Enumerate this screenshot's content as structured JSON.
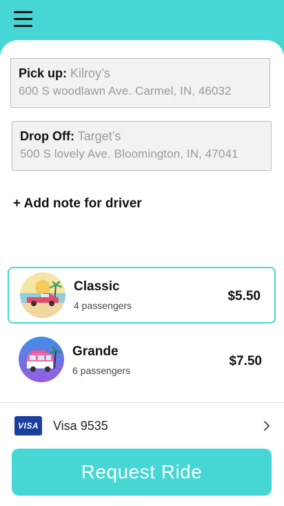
{
  "header": {
    "menu_icon": "hamburger-menu-icon"
  },
  "pickup": {
    "label": "Pick up:",
    "place": "Kilroy’s",
    "address": "600 S woodlawn Ave. Carmel, IN, 46032"
  },
  "dropoff": {
    "label": "Drop Off:",
    "place": "Target’s",
    "address": "500 S lovely Ave. Bloomington, IN, 47041"
  },
  "note": {
    "label": "+ Add note for driver"
  },
  "rides": [
    {
      "name": "Classic",
      "passengers": "4 passengers",
      "price": "$5.50",
      "selected": true,
      "icon": "vintage-car-beach-icon"
    },
    {
      "name": "Grande",
      "passengers": "6 passengers",
      "price": "$7.50",
      "selected": false,
      "icon": "van-beach-icon"
    }
  ],
  "payment": {
    "badge": "VISA",
    "label": "Visa 9535",
    "chevron_icon": "chevron-right-icon"
  },
  "request": {
    "label": "Request Ride"
  },
  "colors": {
    "accent": "#46d6d4",
    "visa_blue": "#1a3f9c"
  }
}
